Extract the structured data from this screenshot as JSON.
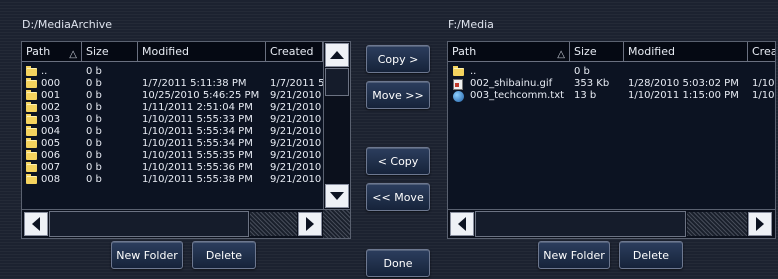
{
  "left_panel": {
    "path": "D:/MediaArchive",
    "columns": [
      "Path",
      "Size",
      "Modified",
      "Created"
    ],
    "rows": [
      {
        "icon": "folder-up-icon",
        "name": "..",
        "size": "0 b",
        "modified": "",
        "created": ""
      },
      {
        "icon": "folder-icon",
        "name": "000",
        "size": "0 b",
        "modified": "1/7/2011 5:11:38 PM",
        "created": "1/7/2011 5"
      },
      {
        "icon": "folder-icon",
        "name": "001",
        "size": "0 b",
        "modified": "10/25/2010 5:46:25 PM",
        "created": "9/21/2010"
      },
      {
        "icon": "folder-icon",
        "name": "002",
        "size": "0 b",
        "modified": "1/11/2011 2:51:04 PM",
        "created": "9/21/2010"
      },
      {
        "icon": "folder-icon",
        "name": "003",
        "size": "0 b",
        "modified": "1/10/2011 5:55:33 PM",
        "created": "9/21/2010"
      },
      {
        "icon": "folder-icon",
        "name": "004",
        "size": "0 b",
        "modified": "1/10/2011 5:55:34 PM",
        "created": "9/21/2010"
      },
      {
        "icon": "folder-icon",
        "name": "005",
        "size": "0 b",
        "modified": "1/10/2011 5:55:34 PM",
        "created": "9/21/2010"
      },
      {
        "icon": "folder-icon",
        "name": "006",
        "size": "0 b",
        "modified": "1/10/2011 5:55:35 PM",
        "created": "9/21/2010"
      },
      {
        "icon": "folder-icon",
        "name": "007",
        "size": "0 b",
        "modified": "1/10/2011 5:55:36 PM",
        "created": "9/21/2010"
      },
      {
        "icon": "folder-icon",
        "name": "008",
        "size": "0 b",
        "modified": "1/10/2011 5:55:38 PM",
        "created": "9/21/2010"
      }
    ],
    "new_folder_label": "New Folder",
    "delete_label": "Delete"
  },
  "right_panel": {
    "path": "F:/Media",
    "columns": [
      "Path",
      "Size",
      "Modified",
      "Crea"
    ],
    "rows": [
      {
        "icon": "folder-up-icon",
        "name": "..",
        "size": "0 b",
        "modified": "",
        "created": ""
      },
      {
        "icon": "gif-file-icon",
        "name": "002_shibainu.gif",
        "size": "353 Kb",
        "modified": "1/28/2010 5:03:02 PM",
        "created": "1/10,"
      },
      {
        "icon": "text-file-icon",
        "name": "003_techcomm.txt",
        "size": "13 b",
        "modified": "1/10/2011 1:15:00 PM",
        "created": "1/10,"
      }
    ],
    "new_folder_label": "New Folder",
    "delete_label": "Delete"
  },
  "actions": {
    "copy_right": "Copy >",
    "move_right": "Move >>",
    "copy_left": "< Copy",
    "move_left": "<< Move",
    "done": "Done"
  },
  "colors": {
    "background": "#1c2230",
    "list_background": "#0c1322",
    "button_top": "#2c3e5e",
    "folder": "#f4d35e"
  }
}
